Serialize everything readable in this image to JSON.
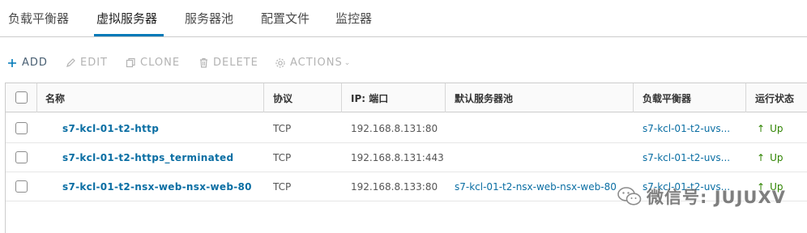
{
  "tabs": [
    {
      "label": "负载平衡器"
    },
    {
      "label": "虚拟服务器"
    },
    {
      "label": "服务器池"
    },
    {
      "label": "配置文件"
    },
    {
      "label": "监控器"
    }
  ],
  "active_tab": "虚拟服务器",
  "toolbar": {
    "add": "ADD",
    "edit": "EDIT",
    "clone": "CLONE",
    "delete": "DELETE",
    "actions": "ACTIONS"
  },
  "columns": {
    "name": "名称",
    "protocol": "协议",
    "ip_port": "IP: 端口",
    "default_pool": "默认服务器池",
    "load_balancer": "负载平衡器",
    "status": "运行状态"
  },
  "rows": [
    {
      "name": "s7-kcl-01-t2-http",
      "protocol": "TCP",
      "ip_port": "192.168.8.131:80",
      "default_pool": "",
      "load_balancer": "s7-kcl-01-t2-uvs...",
      "status": "Up"
    },
    {
      "name": "s7-kcl-01-t2-https_terminated",
      "protocol": "TCP",
      "ip_port": "192.168.8.131:443",
      "default_pool": "",
      "load_balancer": "s7-kcl-01-t2-uvs...",
      "status": "Up"
    },
    {
      "name": "s7-kcl-01-t2-nsx-web-nsx-web-80",
      "protocol": "TCP",
      "ip_port": "192.168.8.133:80",
      "default_pool": "s7-kcl-01-t2-nsx-web-nsx-web-80",
      "load_balancer": "s7-kcl-01-t2-uvs...",
      "status": "Up"
    }
  ],
  "watermark": {
    "text": "微信号: JUJUXV"
  },
  "colors": {
    "accent": "#0079b8",
    "link": "#0a6ea3",
    "status_up": "#2f8400",
    "disabled": "#b3b3b3"
  },
  "icons": {
    "add": "plus-icon",
    "edit": "pencil-icon",
    "clone": "copy-icon",
    "delete": "trash-icon",
    "actions": "gear-icon",
    "status": "arrow-up-icon"
  }
}
